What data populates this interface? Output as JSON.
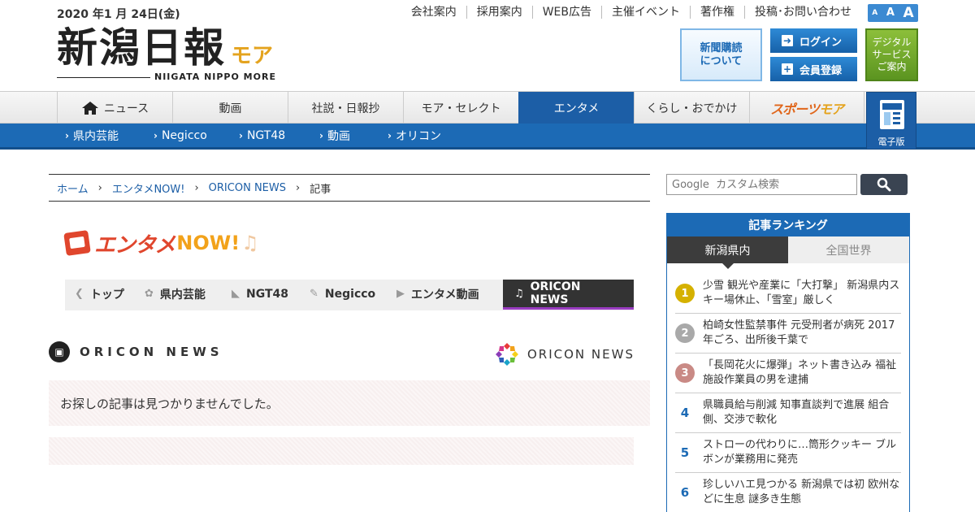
{
  "header": {
    "date": "2020 年1 月 24日(金)",
    "logo_main": "新潟日報",
    "logo_more": "モア",
    "logo_sub": "NIIGATA NIPPO MORE",
    "top_links": [
      "会社案内",
      "採用案内",
      "WEB広告",
      "主催イベント",
      "著作権",
      "投稿･お問い合わせ"
    ],
    "font_sizes": [
      "A",
      "A",
      "A"
    ],
    "subscribe_line1": "新聞購読",
    "subscribe_line2": "について",
    "login_label": "ログイン",
    "register_label": "会員登録",
    "digital_line1": "デジタル",
    "digital_line2": "サービス",
    "digital_line3": "ご案内"
  },
  "main_nav": {
    "items": [
      "ニュース",
      "動画",
      "社説・日報抄",
      "モア・セレクト",
      "エンタメ",
      "くらし・おでかけ"
    ],
    "sports_label_a": "スポーツ",
    "sports_label_b": "モア",
    "edition_label": "電子版",
    "active_index": 4,
    "accent_color": "#1c5ea6"
  },
  "sub_nav": {
    "items": [
      "県内芸能",
      "Negicco",
      "NGT48",
      "動画",
      "オリコン"
    ]
  },
  "breadcrumb": {
    "home": "ホーム",
    "level1": "エンタメNOW!",
    "level2": "ORICON NEWS",
    "current": "記事",
    "separator": "›"
  },
  "enta_logo": {
    "text": "エンタメ",
    "now": "NOW!",
    "note": "♫"
  },
  "enta_tabs": {
    "items": [
      "トップ",
      "県内芸能",
      "NGT48",
      "Negicco",
      "エンタメ動画",
      "ORICON NEWS"
    ]
  },
  "section": {
    "title": "ORICON NEWS",
    "logo_text": "ORICON NEWS",
    "not_found": "お探しの記事は見つかりませんでした。"
  },
  "sidebar": {
    "search_placeholder": "Google  カスタム検索",
    "ranking_title": "記事ランキング",
    "tab_local": "新潟県内",
    "tab_world": "全国世界",
    "ranking": [
      {
        "rank": "1",
        "text": "少雪 観光や産業に「大打撃」 新潟県内スキー場休止、「雪室」厳しく"
      },
      {
        "rank": "2",
        "text": "柏崎女性監禁事件 元受刑者が病死 2017年ごろ、出所後千葉で"
      },
      {
        "rank": "3",
        "text": "「長岡花火に爆弾」ネット書き込み 福祉施設作業員の男を逮捕"
      },
      {
        "rank": "4",
        "text": "県職員給与削減 知事直談判で進展 組合側、交渉で軟化"
      },
      {
        "rank": "5",
        "text": "ストローの代わりに…筒形クッキー ブルボンが業務用に発売"
      },
      {
        "rank": "6",
        "text": "珍しいハエ見つかる 新潟県では初 欧州などに生息 謎多き生態"
      }
    ]
  }
}
